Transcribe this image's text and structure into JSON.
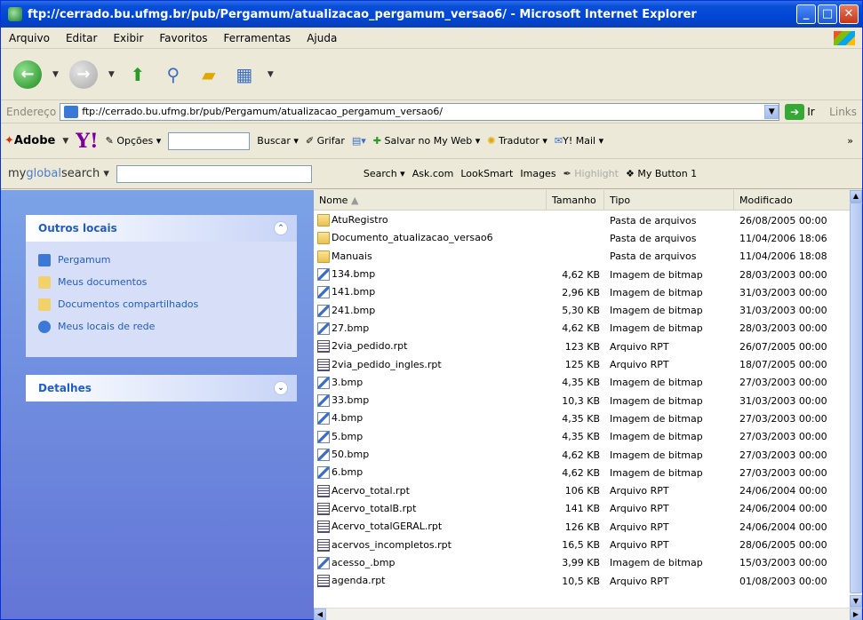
{
  "window": {
    "title": "ftp://cerrado.bu.ufmg.br/pub/Pergamum/atualizacao_pergamum_versao6/ - Microsoft Internet Explorer"
  },
  "menu": [
    "Arquivo",
    "Editar",
    "Exibir",
    "Favoritos",
    "Ferramentas",
    "Ajuda"
  ],
  "address": {
    "label": "Endereço",
    "value": "ftp://cerrado.bu.ufmg.br/pub/Pergamum/atualizacao_pergamum_versao6/",
    "go": "Ir",
    "links": "Links"
  },
  "yahoo": {
    "adobe": "Adobe",
    "y": "Y!",
    "opcoes": "Opções",
    "buscar": "Buscar",
    "grifar": "Grifar",
    "salvar": "Salvar no My Web",
    "tradutor": "Tradutor",
    "mail": "Y! Mail"
  },
  "globalsearch": {
    "logo_a": "my",
    "logo_b": "global",
    "logo_c": "search",
    "search": "Search",
    "ask": "Ask.com",
    "looksmart": "LookSmart",
    "images": "Images",
    "highlight": "Highlight",
    "mybutton": "My Button 1"
  },
  "sidebar": {
    "outros_title": "Outros locais",
    "links": [
      "Pergamum",
      "Meus documentos",
      "Documentos compartilhados",
      "Meus locais de rede"
    ],
    "detalhes_title": "Detalhes"
  },
  "columns": {
    "nome": "Nome",
    "tamanho": "Tamanho",
    "tipo": "Tipo",
    "modificado": "Modificado"
  },
  "files": [
    {
      "name": "AtuRegistro",
      "size": "",
      "type": "Pasta de arquivos",
      "date": "26/08/2005 00:00",
      "icon": "folder"
    },
    {
      "name": "Documento_atualizacao_versao6",
      "size": "",
      "type": "Pasta de arquivos",
      "date": "11/04/2006 18:06",
      "icon": "folder"
    },
    {
      "name": "Manuais",
      "size": "",
      "type": "Pasta de arquivos",
      "date": "11/04/2006 18:08",
      "icon": "folder"
    },
    {
      "name": "134.bmp",
      "size": "4,62 KB",
      "type": "Imagem de bitmap",
      "date": "28/03/2003 00:00",
      "icon": "bmp"
    },
    {
      "name": "141.bmp",
      "size": "2,96 KB",
      "type": "Imagem de bitmap",
      "date": "31/03/2003 00:00",
      "icon": "bmp"
    },
    {
      "name": "241.bmp",
      "size": "5,30 KB",
      "type": "Imagem de bitmap",
      "date": "31/03/2003 00:00",
      "icon": "bmp"
    },
    {
      "name": "27.bmp",
      "size": "4,62 KB",
      "type": "Imagem de bitmap",
      "date": "28/03/2003 00:00",
      "icon": "bmp"
    },
    {
      "name": "2via_pedido.rpt",
      "size": "123 KB",
      "type": "Arquivo RPT",
      "date": "26/07/2005 00:00",
      "icon": "rpt"
    },
    {
      "name": "2via_pedido_ingles.rpt",
      "size": "125 KB",
      "type": "Arquivo RPT",
      "date": "18/07/2005 00:00",
      "icon": "rpt"
    },
    {
      "name": "3.bmp",
      "size": "4,35 KB",
      "type": "Imagem de bitmap",
      "date": "27/03/2003 00:00",
      "icon": "bmp"
    },
    {
      "name": "33.bmp",
      "size": "10,3 KB",
      "type": "Imagem de bitmap",
      "date": "31/03/2003 00:00",
      "icon": "bmp"
    },
    {
      "name": "4.bmp",
      "size": "4,35 KB",
      "type": "Imagem de bitmap",
      "date": "27/03/2003 00:00",
      "icon": "bmp"
    },
    {
      "name": "5.bmp",
      "size": "4,35 KB",
      "type": "Imagem de bitmap",
      "date": "27/03/2003 00:00",
      "icon": "bmp"
    },
    {
      "name": "50.bmp",
      "size": "4,62 KB",
      "type": "Imagem de bitmap",
      "date": "27/03/2003 00:00",
      "icon": "bmp"
    },
    {
      "name": "6.bmp",
      "size": "4,62 KB",
      "type": "Imagem de bitmap",
      "date": "27/03/2003 00:00",
      "icon": "bmp"
    },
    {
      "name": "Acervo_total.rpt",
      "size": "106 KB",
      "type": "Arquivo RPT",
      "date": "24/06/2004 00:00",
      "icon": "rpt"
    },
    {
      "name": "Acervo_totalB.rpt",
      "size": "141 KB",
      "type": "Arquivo RPT",
      "date": "24/06/2004 00:00",
      "icon": "rpt"
    },
    {
      "name": "Acervo_totalGERAL.rpt",
      "size": "126 KB",
      "type": "Arquivo RPT",
      "date": "24/06/2004 00:00",
      "icon": "rpt"
    },
    {
      "name": "acervos_incompletos.rpt",
      "size": "16,5 KB",
      "type": "Arquivo RPT",
      "date": "28/06/2005 00:00",
      "icon": "rpt"
    },
    {
      "name": "acesso_.bmp",
      "size": "3,99 KB",
      "type": "Imagem de bitmap",
      "date": "15/03/2003 00:00",
      "icon": "bmp"
    },
    {
      "name": "agenda.rpt",
      "size": "10,5 KB",
      "type": "Arquivo RPT",
      "date": "01/08/2003 00:00",
      "icon": "rpt"
    }
  ]
}
